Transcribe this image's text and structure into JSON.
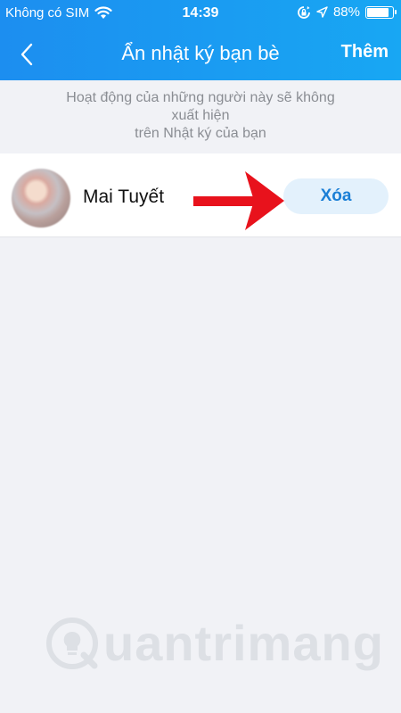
{
  "status_bar": {
    "carrier": "Không có SIM",
    "time": "14:39",
    "battery_percent": "88%",
    "battery_level": 0.88,
    "icons": [
      "wifi-icon",
      "rotation-lock-icon",
      "location-arrow-icon",
      "battery-icon"
    ]
  },
  "nav": {
    "back_icon": "chevron-left-icon",
    "title": "Ẩn nhật ký bạn bè",
    "add_label": "Thêm"
  },
  "hint": {
    "line1": "Hoạt động của những người này sẽ không",
    "line2": "xuất hiện",
    "line3": "trên Nhật ký của bạn"
  },
  "list": {
    "items": [
      {
        "name": "Mai Tuyết",
        "action_label": "Xóa"
      }
    ]
  },
  "annotation": {
    "arrow_color": "#e8121c"
  },
  "watermark": {
    "text": "uantrimang",
    "logo_icon": "lightbulb-q-icon"
  },
  "colors": {
    "header_start": "#1c8ef0",
    "header_end": "#18a7f3",
    "action_text": "#1b7fd6",
    "action_bg": "#e3f1fc"
  }
}
